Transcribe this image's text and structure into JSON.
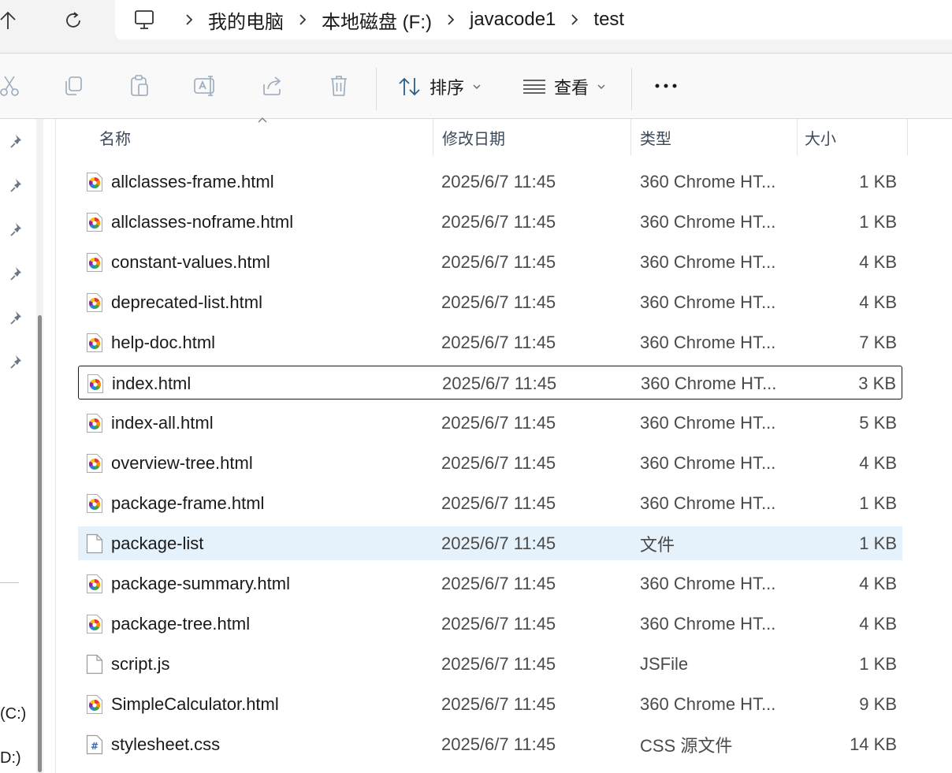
{
  "breadcrumb": {
    "items": [
      "我的电脑",
      "本地磁盘 (F:)",
      "javacode1",
      "test"
    ]
  },
  "commandbar": {
    "sort_label": "排序",
    "view_label": "查看"
  },
  "sidebar": {
    "drives": [
      "(C:)",
      "D:)"
    ]
  },
  "columns": {
    "name": "名称",
    "date": "修改日期",
    "type": "类型",
    "size": "大小"
  },
  "files": [
    {
      "name": "allclasses-frame.html",
      "date": "2025/6/7 11:45",
      "type": "360 Chrome HT...",
      "size": "1 KB",
      "icon": "chrome-html-icon"
    },
    {
      "name": "allclasses-noframe.html",
      "date": "2025/6/7 11:45",
      "type": "360 Chrome HT...",
      "size": "1 KB",
      "icon": "chrome-html-icon"
    },
    {
      "name": "constant-values.html",
      "date": "2025/6/7 11:45",
      "type": "360 Chrome HT...",
      "size": "4 KB",
      "icon": "chrome-html-icon"
    },
    {
      "name": "deprecated-list.html",
      "date": "2025/6/7 11:45",
      "type": "360 Chrome HT...",
      "size": "4 KB",
      "icon": "chrome-html-icon"
    },
    {
      "name": "help-doc.html",
      "date": "2025/6/7 11:45",
      "type": "360 Chrome HT...",
      "size": "7 KB",
      "icon": "chrome-html-icon"
    },
    {
      "name": "index.html",
      "date": "2025/6/7 11:45",
      "type": "360 Chrome HT...",
      "size": "3 KB",
      "icon": "chrome-html-icon",
      "state": "selected"
    },
    {
      "name": "index-all.html",
      "date": "2025/6/7 11:45",
      "type": "360 Chrome HT...",
      "size": "5 KB",
      "icon": "chrome-html-icon"
    },
    {
      "name": "overview-tree.html",
      "date": "2025/6/7 11:45",
      "type": "360 Chrome HT...",
      "size": "4 KB",
      "icon": "chrome-html-icon"
    },
    {
      "name": "package-frame.html",
      "date": "2025/6/7 11:45",
      "type": "360 Chrome HT...",
      "size": "1 KB",
      "icon": "chrome-html-icon"
    },
    {
      "name": "package-list",
      "date": "2025/6/7 11:45",
      "type": "文件",
      "size": "1 KB",
      "icon": "blank-file-icon",
      "state": "hover"
    },
    {
      "name": "package-summary.html",
      "date": "2025/6/7 11:45",
      "type": "360 Chrome HT...",
      "size": "4 KB",
      "icon": "chrome-html-icon"
    },
    {
      "name": "package-tree.html",
      "date": "2025/6/7 11:45",
      "type": "360 Chrome HT...",
      "size": "4 KB",
      "icon": "chrome-html-icon"
    },
    {
      "name": "script.js",
      "date": "2025/6/7 11:45",
      "type": "JSFile",
      "size": "1 KB",
      "icon": "blank-file-icon"
    },
    {
      "name": "SimpleCalculator.html",
      "date": "2025/6/7 11:45",
      "type": "360 Chrome HT...",
      "size": "9 KB",
      "icon": "chrome-html-icon"
    },
    {
      "name": "stylesheet.css",
      "date": "2025/6/7 11:45",
      "type": "CSS 源文件",
      "size": "14 KB",
      "icon": "css-file-icon"
    }
  ],
  "colors": {
    "selected_border": "#1a1a1a",
    "hover_background": "#e5f1fb",
    "toolbar_background": "#f9f9f9"
  }
}
